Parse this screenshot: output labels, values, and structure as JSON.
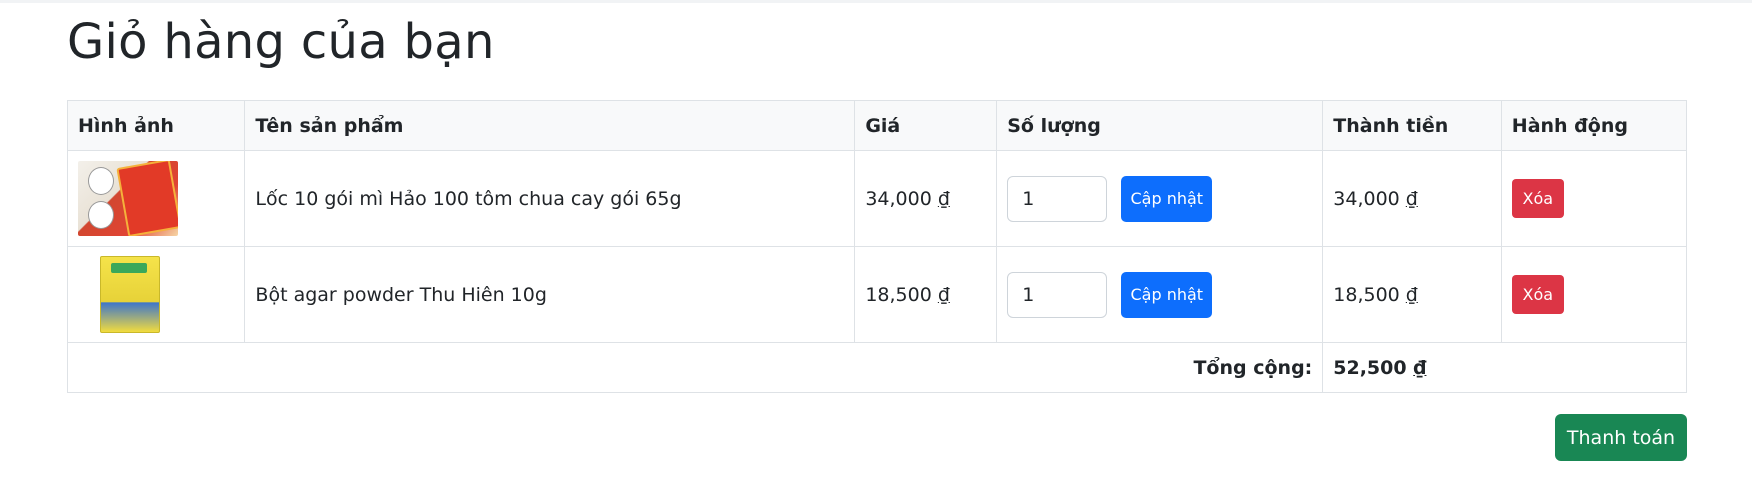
{
  "page": {
    "title": "Giỏ hàng của bạn"
  },
  "table": {
    "headers": [
      "Hình ảnh",
      "Tên sản phẩm",
      "Giá",
      "Số lượng",
      "Thành tiền",
      "Hành động"
    ],
    "rows": [
      {
        "image_icon": "noodle-pack-image",
        "name": "Lốc 10 gói mì Hảo 100 tôm chua cay gói 65g",
        "price": "34,000",
        "quantity": "1",
        "update_label": "Cập nhật",
        "subtotal": "34,000",
        "delete_label": "Xóa"
      },
      {
        "image_icon": "agar-powder-image",
        "name": "Bột agar powder Thu Hiên 10g",
        "price": "18,500",
        "quantity": "1",
        "update_label": "Cập nhật",
        "subtotal": "18,500",
        "delete_label": "Xóa"
      }
    ],
    "currency": "₫",
    "total_label": "Tổng cộng:",
    "total_value": "52,500"
  },
  "checkout": {
    "label": "Thanh toán"
  },
  "colors": {
    "primary": "#0d6efd",
    "danger": "#dc3545",
    "success": "#198754",
    "header_bg": "#f8f9fa"
  }
}
